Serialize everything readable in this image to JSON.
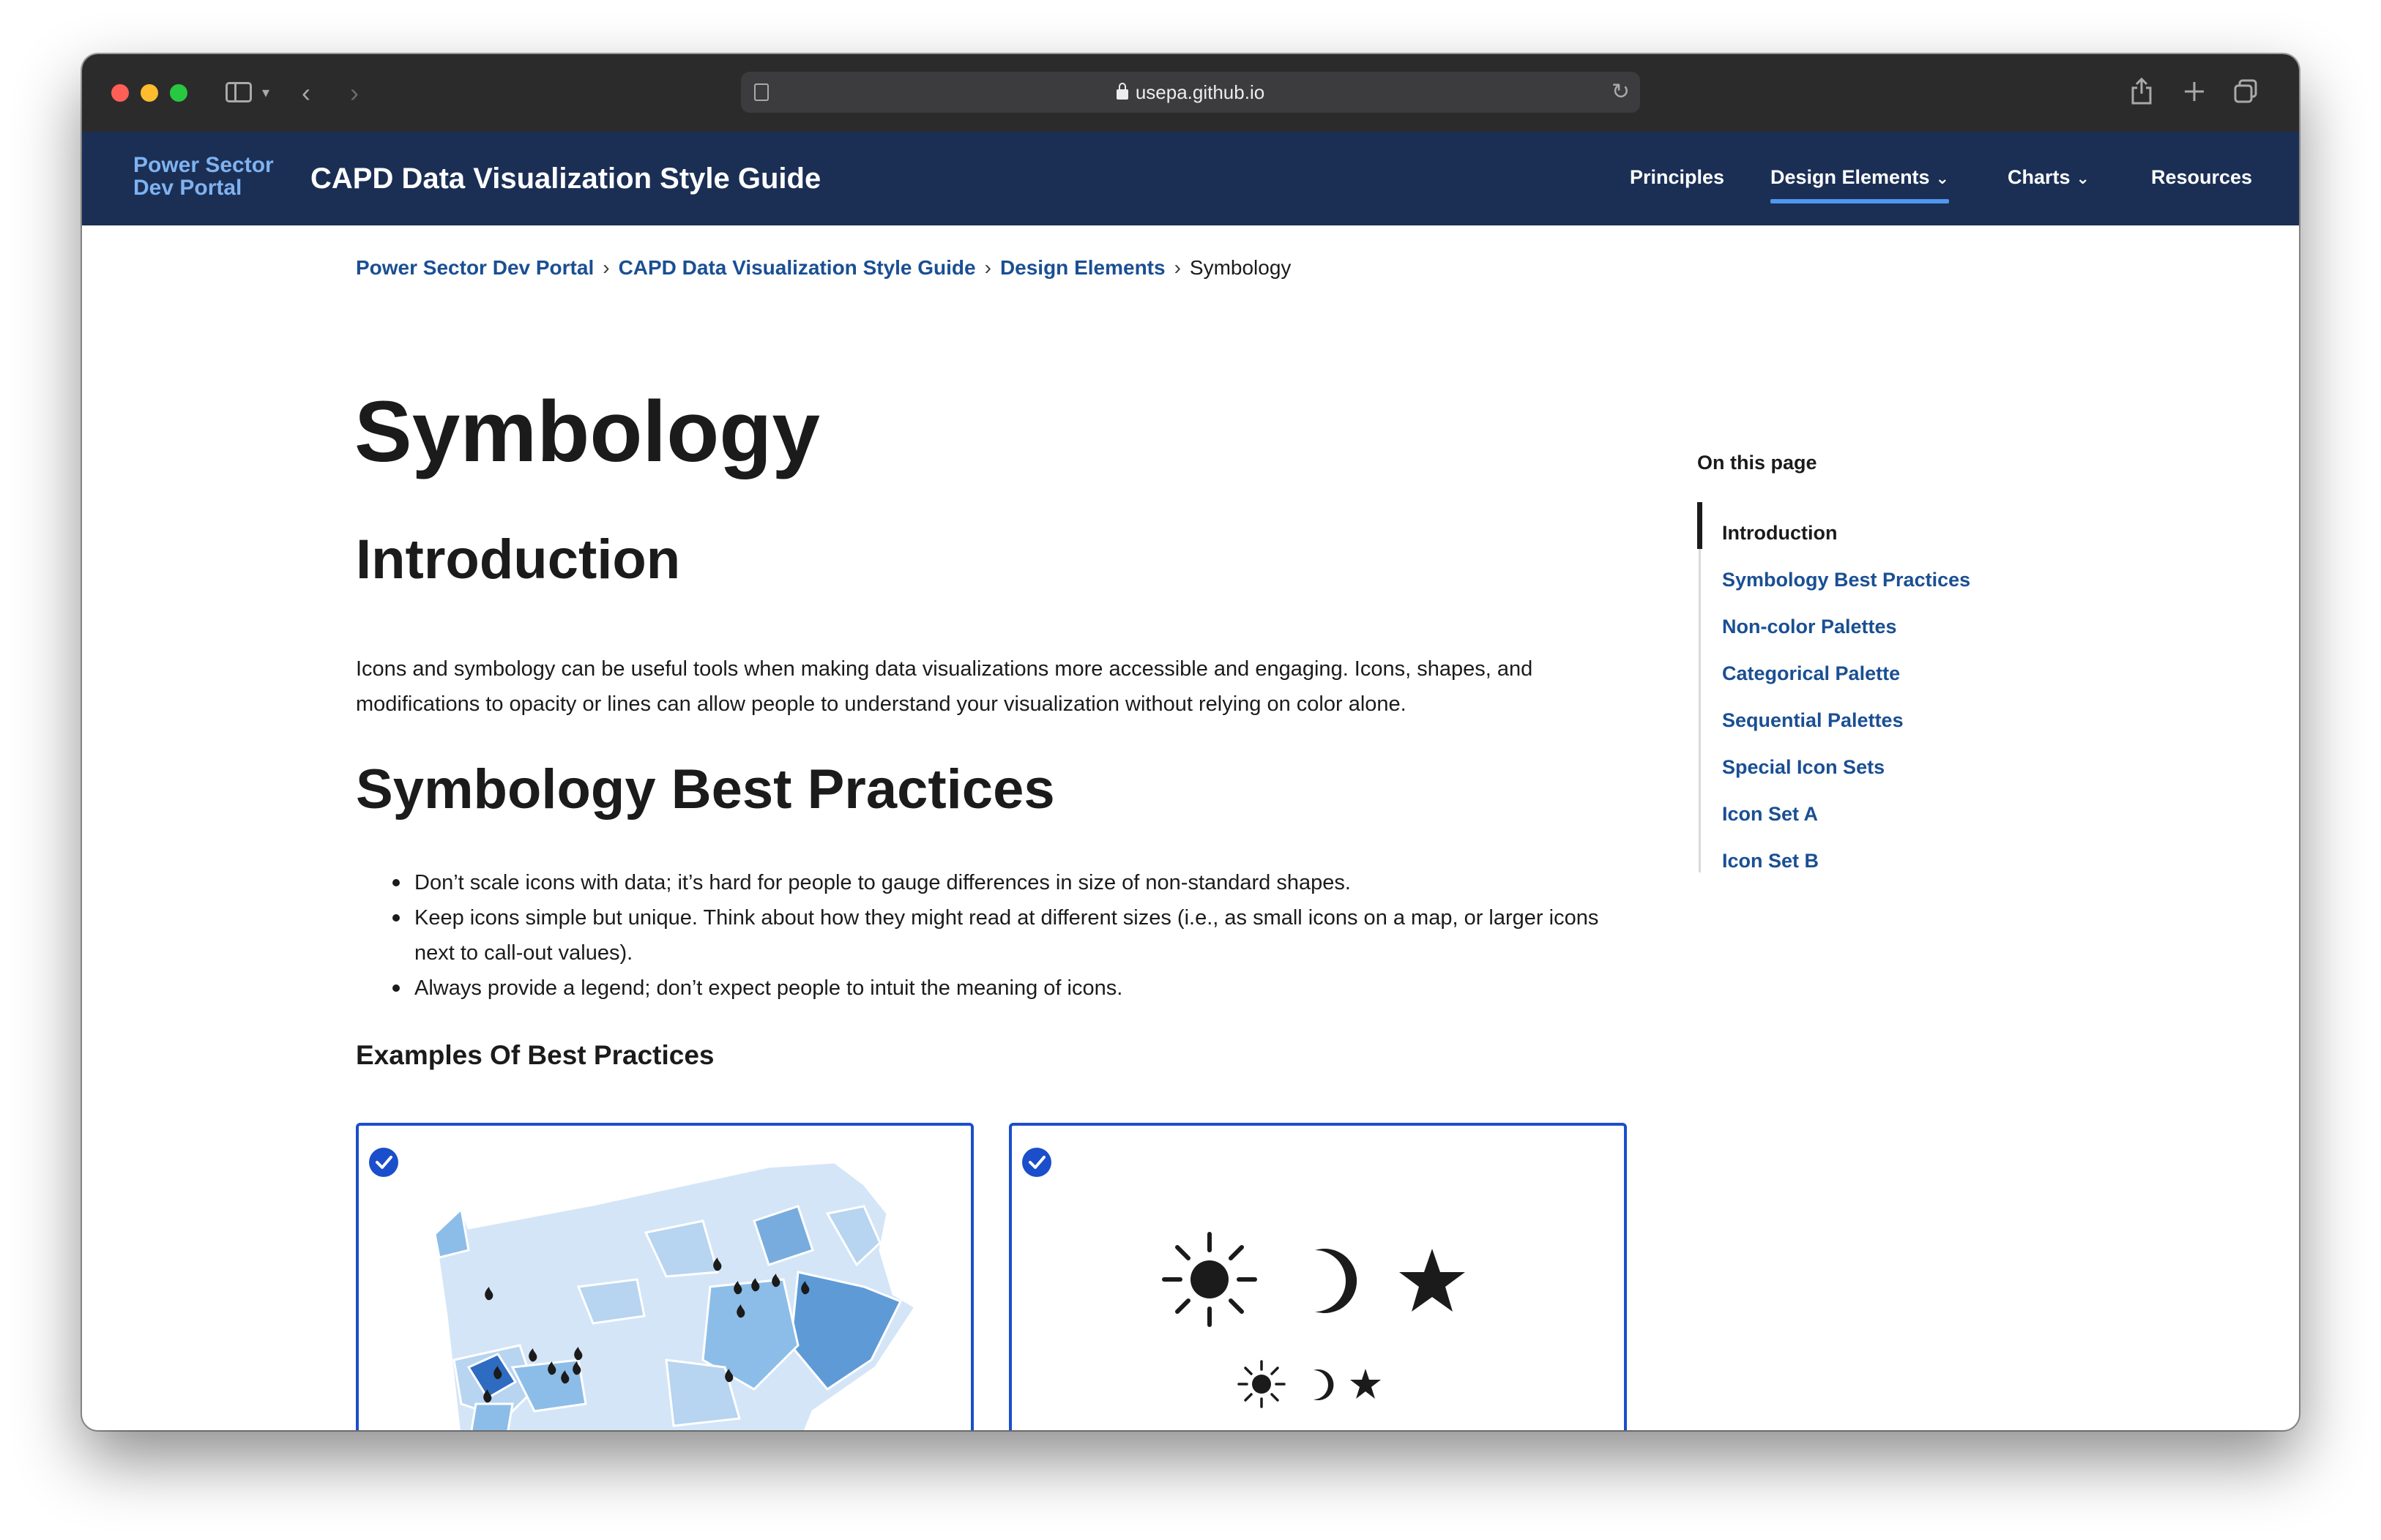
{
  "browser": {
    "url": "usepa.github.io"
  },
  "header": {
    "portal_line1": "Power Sector",
    "portal_line2": "Dev Portal",
    "site_title": "CAPD Data Visualization Style Guide",
    "nav": [
      {
        "label": "Principles"
      },
      {
        "label": "Design Elements",
        "active": true
      },
      {
        "label": "Charts"
      },
      {
        "label": "Resources"
      }
    ]
  },
  "breadcrumb": {
    "items": [
      "Power Sector Dev Portal",
      "CAPD Data Visualization Style Guide",
      "Design Elements"
    ],
    "current": "Symbology",
    "separator": "›"
  },
  "main": {
    "title": "Symbology",
    "intro_heading": "Introduction",
    "intro_line1": "Icons and symbology can be useful tools when making data visualizations more accessible and engaging. Icons, shapes, and",
    "intro_line2": "modifications to opacity or lines can allow people to understand your visualization without relying on color alone.",
    "practices_heading": "Symbology Best Practices",
    "bullets": [
      "Don’t scale icons with data; it’s hard for people to gauge differences in size of non-standard shapes.",
      "Keep icons simple but unique. Think about how they might read at different sizes (i.e., as small icons on a map, or larger icons next to call-out values).",
      "Always provide a legend; don’t expect people to intuit the meaning of icons."
    ],
    "examples_heading": "Examples Of Best Practices"
  },
  "toc": {
    "heading": "On this page",
    "items": [
      "Introduction",
      "Symbology Best Practices",
      "Non-color Palettes",
      "Categorical Palette",
      "Sequential Palettes",
      "Special Icon Sets",
      "Icon Set A",
      "Icon Set B"
    ],
    "active_index": 0
  },
  "colors": {
    "header_bg": "#1b2f55",
    "link": "#1a4f93",
    "accent": "#1a4ecb",
    "nav_underline": "#4f97ee"
  }
}
